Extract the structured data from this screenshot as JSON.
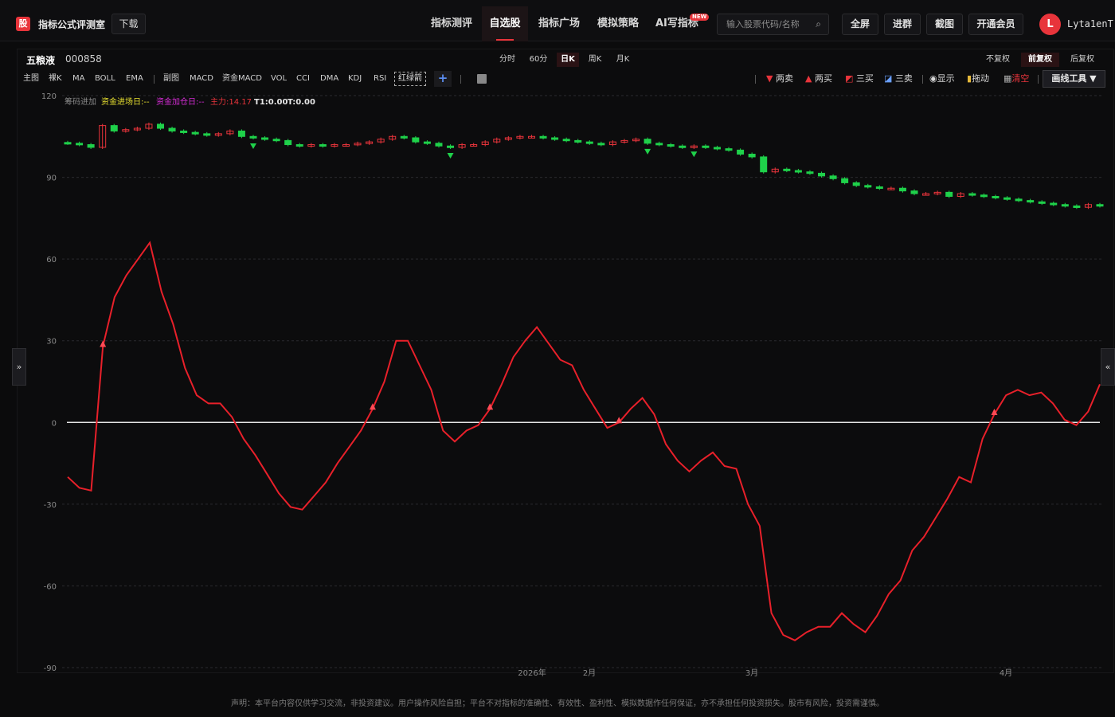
{
  "header": {
    "logo_char": "股",
    "app_title": "指标公式评测室",
    "download": "下载",
    "nav": [
      "指标测评",
      "自选股",
      "指标广场",
      "模拟策略",
      "AI写指标"
    ],
    "active_nav": "自选股",
    "new_badge": "NEW",
    "search_placeholder": "输入股票代码/名称",
    "fullscreen": "全屏",
    "join_group": "进群",
    "screenshot": "截图",
    "vip": "开通会员",
    "avatar_letter": "L",
    "username": "Lyta1enT"
  },
  "stock": {
    "name": "五粮液",
    "code": "000858"
  },
  "periods": [
    "分时",
    "60分",
    "日K",
    "周K",
    "月K"
  ],
  "active_period": "日K",
  "adjust": [
    "不复权",
    "前复权",
    "后复权"
  ],
  "active_adjust": "前复权",
  "indicators_main": [
    "主图",
    "裸K",
    "MA",
    "BOLL",
    "EMA"
  ],
  "indicators_sub": [
    "副图",
    "MACD",
    "资金MACD",
    "VOL",
    "CCI",
    "DMA",
    "KDJ",
    "RSI"
  ],
  "indicator_custom": "红绿箭",
  "tools": {
    "sell2": "两卖",
    "buy2": "两买",
    "buy3": "三买",
    "sell3": "三卖",
    "show": "显示",
    "drag": "拖动",
    "clear": "清空",
    "draw_tools": "画线工具 ▼"
  },
  "legend": {
    "a": "筹码进加",
    "b": "资金进场日:--",
    "c": "资金加仓日:--",
    "d": "主力:14.17",
    "e": "T1:0.00",
    "f": "T:0.00"
  },
  "toggles": {
    "left": "»",
    "right": "«"
  },
  "disclaimer": "声明：本平台内容仅供学习交流，非投资建议。用户操作风险自担；平台不对指标的准确性、有效性、盈利性、模拟数据作任何保证，亦不承担任何投资损失。股市有风险，投资需谨慎。",
  "chart_data": {
    "type": "line",
    "y_ticks": [
      120,
      90,
      60,
      30,
      0,
      -30,
      -60,
      -90
    ],
    "ylim": [
      -90,
      120
    ],
    "x_labels": [
      "2026年",
      "2月",
      "3月",
      "4月"
    ],
    "colors": {
      "line": "#e8202a",
      "zero": "#e6e6e6",
      "up": "#e8343b",
      "down": "#1fd14a"
    },
    "candles_close": [
      102.5,
      102,
      101,
      109,
      107,
      107.5,
      108,
      109.5,
      108,
      107,
      106.5,
      106,
      105.5,
      106,
      107,
      105,
      104.5,
      104,
      103.5,
      102,
      101.5,
      102,
      101.5,
      102,
      102,
      102.5,
      103,
      104,
      105,
      104.5,
      103,
      102.5,
      101.5,
      101,
      102,
      102,
      103,
      104,
      104.5,
      105,
      105,
      104.5,
      104,
      103.5,
      103,
      102.5,
      102,
      103,
      103.5,
      104,
      102.5,
      102,
      101.5,
      101,
      101.5,
      101,
      100.5,
      100,
      98.5,
      97.5,
      92,
      93,
      92.5,
      92,
      91.5,
      90.5,
      89.5,
      88,
      87,
      86.5,
      86,
      86,
      85,
      84,
      84,
      84.5,
      83,
      84,
      83.5,
      83,
      82.5,
      82,
      81.5,
      81,
      80.5,
      80,
      79.5,
      79,
      80,
      79.5
    ],
    "line_values": [
      -20,
      -24,
      -25,
      28,
      46,
      54,
      60,
      66,
      48,
      36,
      20,
      10,
      7,
      7,
      2,
      -6,
      -12,
      -19,
      -26,
      -31,
      -32,
      -27,
      -22,
      -15,
      -9,
      -3,
      5,
      15,
      30,
      30,
      21,
      12,
      -3,
      -7,
      -3,
      -1,
      5,
      14,
      24,
      30,
      35,
      29,
      23,
      21,
      12,
      5,
      -2,
      0,
      5,
      9,
      3,
      -8,
      -14,
      -18,
      -14,
      -11,
      -16,
      -17,
      -30,
      -38,
      -70,
      -78,
      -80,
      -77,
      -75,
      -75,
      -70,
      -74,
      -77,
      -71,
      -63,
      -58,
      -47,
      -42,
      -35,
      -28,
      -20,
      -22,
      -6,
      3,
      10,
      12,
      10,
      11,
      7,
      1,
      -1,
      4,
      14
    ],
    "buy_markers_at": [
      3,
      26,
      36,
      47,
      79
    ],
    "sell_markers_at": [
      16,
      33,
      49,
      53
    ]
  }
}
